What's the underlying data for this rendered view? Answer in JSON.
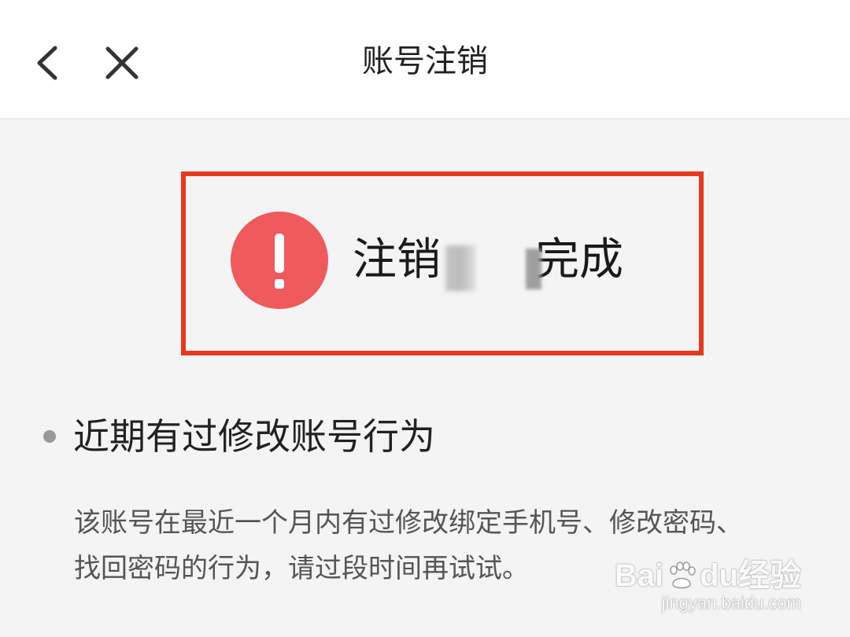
{
  "header": {
    "title": "账号注销"
  },
  "status": {
    "text": "注销",
    "text_suffix": "完成",
    "icon": "exclamation-circle-icon",
    "icon_color": "#ef5a5d",
    "highlight_color": "#e8391f"
  },
  "reason": {
    "title": "近期有过修改账号行为",
    "description": "该账号在最近一个月内有过修改绑定手机号、修改密码、找回密码的行为，请过段时间再试试。"
  },
  "watermark": {
    "brand_prefix": "Bai",
    "brand_du": "du",
    "brand_suffix": "经验",
    "domain": "jingyan.baidu.com"
  }
}
